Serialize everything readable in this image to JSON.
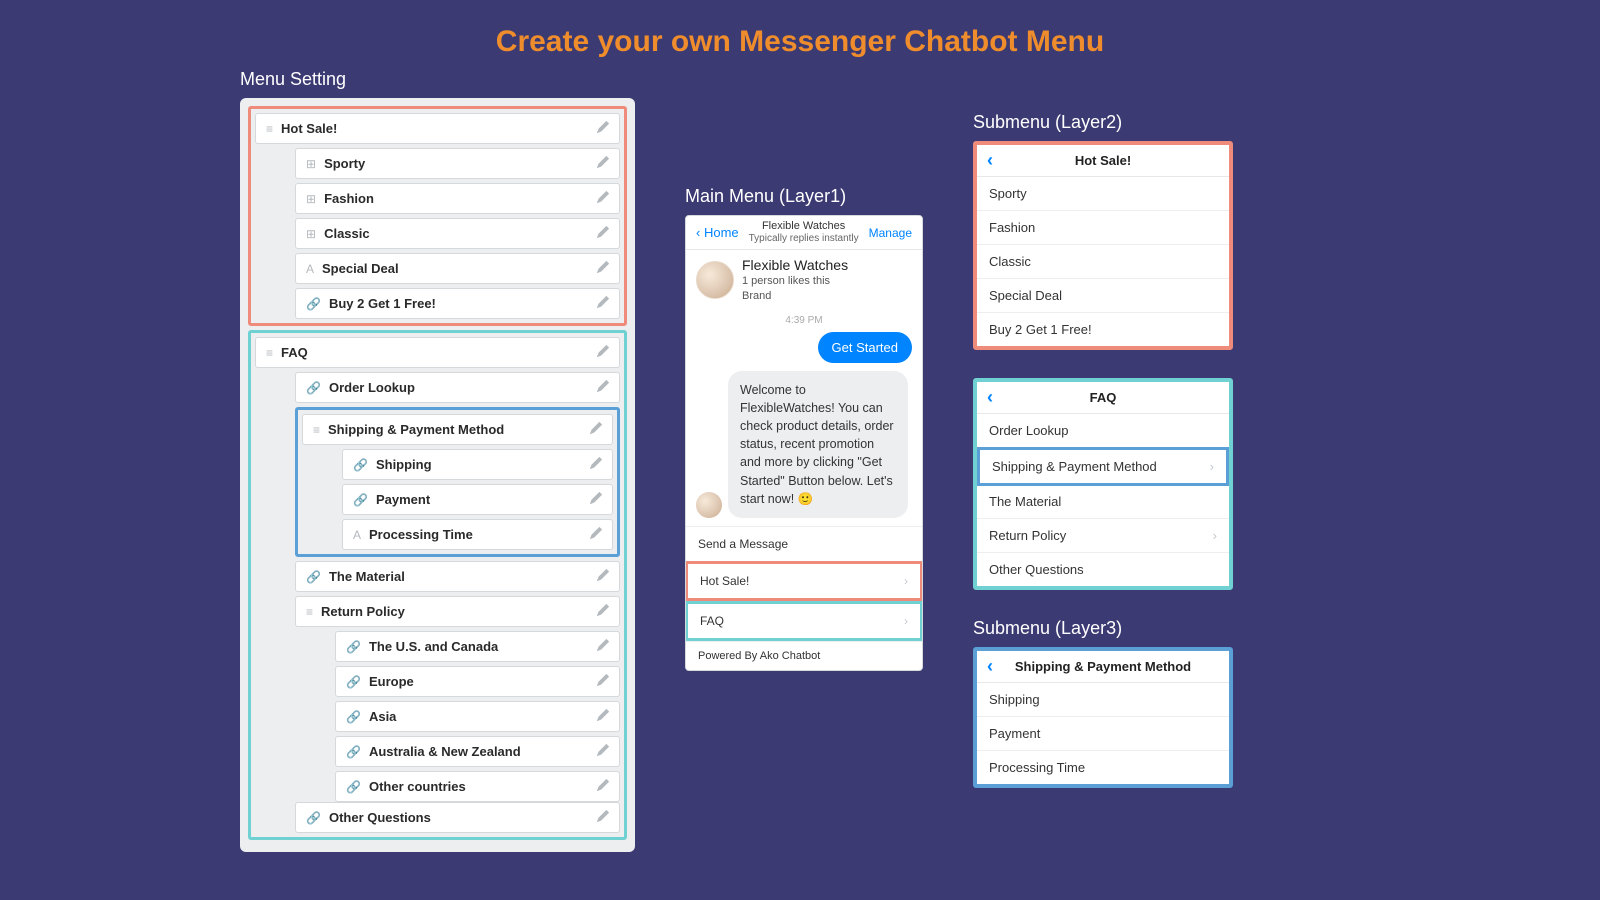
{
  "title": "Create your own Messenger Chatbot Menu",
  "labels": {
    "menuSetting": "Menu Setting",
    "mainMenu": "Main Menu (Layer1)",
    "sub2": "Submenu (Layer2)",
    "sub3": "Submenu (Layer3)"
  },
  "menu": {
    "hotSale": "Hot Sale!",
    "sporty": "Sporty",
    "fashion": "Fashion",
    "classic": "Classic",
    "specialDeal": "Special Deal",
    "buy2": "Buy 2 Get 1 Free!",
    "faq": "FAQ",
    "orderLookup": "Order Lookup",
    "shipPay": "Shipping & Payment Method",
    "shipping": "Shipping",
    "payment": "Payment",
    "processing": "Processing Time",
    "material": "The Material",
    "returnPolicy": "Return Policy",
    "usCanada": "The U.S. and Canada",
    "europe": "Europe",
    "asia": "Asia",
    "ausNZ": "Australia & New Zealand",
    "otherCountries": "Other countries",
    "otherQuestions": "Other Questions"
  },
  "phone": {
    "back": "Home",
    "brand": "Flexible Watches",
    "subline": "Typically replies instantly",
    "manage": "Manage",
    "profileName": "Flexible Watches",
    "likes": "1 person likes this",
    "type": "Brand",
    "time": "4:39 PM",
    "getStarted": "Get Started",
    "welcome": "Welcome to FlexibleWatches! You can check product details, order status, recent promotion and more by clicking \"Get Started\" Button below. Let's start now! 🙂",
    "sendMsg": "Send a Message",
    "opt1": "Hot Sale!",
    "opt2": "FAQ",
    "powered": "Powered By Ako Chatbot"
  },
  "sub2a": {
    "title": "Hot Sale!",
    "items": [
      "Sporty",
      "Fashion",
      "Classic",
      "Special Deal",
      "Buy 2 Get 1 Free!"
    ]
  },
  "sub2b": {
    "title": "FAQ",
    "items": [
      "Order Lookup",
      "Shipping & Payment Method",
      "The Material",
      "Return Policy",
      "Other Questions"
    ]
  },
  "sub3": {
    "title": "Shipping & Payment Method",
    "items": [
      "Shipping",
      "Payment",
      "Processing Time"
    ]
  }
}
